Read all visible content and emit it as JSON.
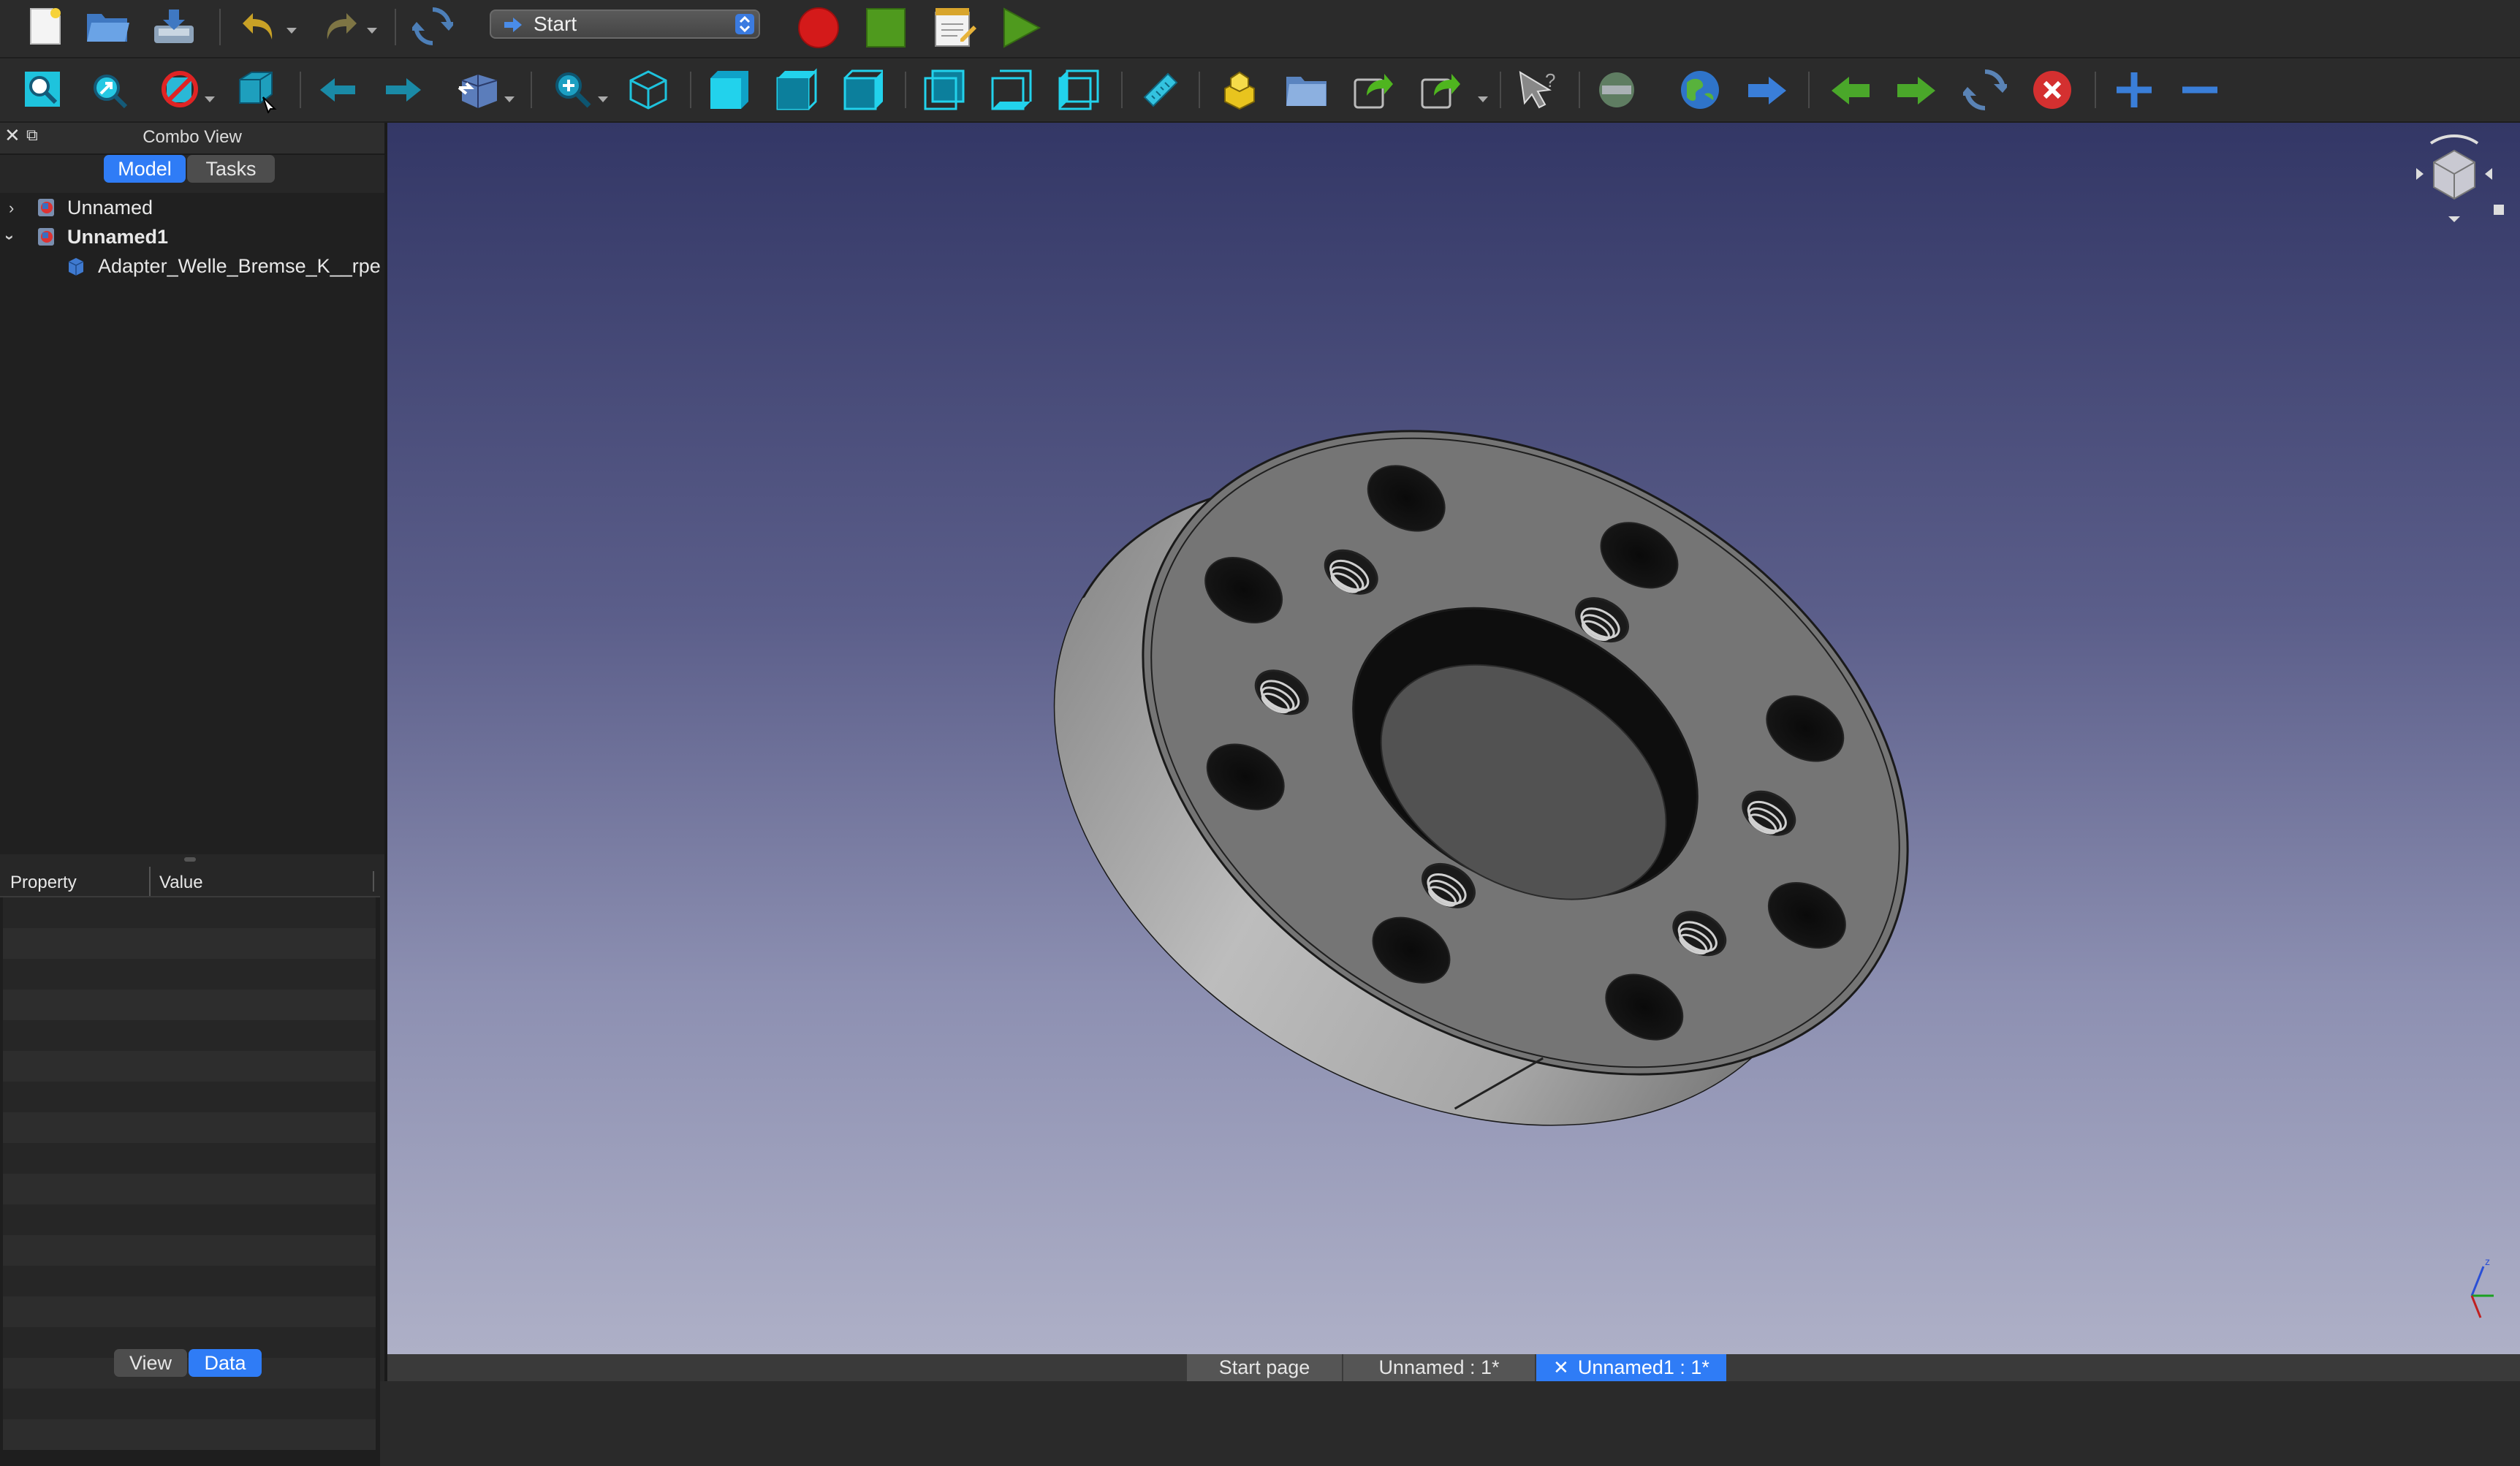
{
  "toolbar_top": {
    "workbench": "Start"
  },
  "combo_view": {
    "title": "Combo View",
    "tabs": [
      "Model",
      "Tasks"
    ],
    "active_tab": "Model",
    "tree": [
      {
        "label": "Unnamed",
        "expanded": false,
        "bold": false
      },
      {
        "label": "Unnamed1",
        "expanded": true,
        "bold": true
      },
      {
        "label": "Adapter_Welle_Bremse_K__rpe",
        "child": true
      }
    ]
  },
  "property_panel": {
    "columns": [
      "Property",
      "Value"
    ],
    "tabs": [
      "View",
      "Data"
    ],
    "active_tab": "Data"
  },
  "document_tabs": [
    {
      "label": "Start page",
      "active": false
    },
    {
      "label": "Unnamed : 1*",
      "active": false
    },
    {
      "label": "Unnamed1 : 1*",
      "active": true
    }
  ],
  "colors": {
    "accent": "#2f7cf6",
    "viewport_top": "#333766",
    "viewport_bottom": "#aeb0c7",
    "record": "#d41a1a",
    "stop": "#4f9a1e"
  },
  "icons": {
    "file": [
      "new-document-icon",
      "open-folder-icon",
      "save-icon",
      "undo-icon",
      "redo-icon",
      "refresh-icon"
    ],
    "macro": [
      "record-macro-icon",
      "stop-macro-icon",
      "edit-macro-icon",
      "run-macro-icon"
    ],
    "view": [
      "fit-all-icon",
      "fit-selection-icon",
      "draw-style-icon",
      "bounding-box-icon",
      "back-icon",
      "forward-icon",
      "std-views-icon",
      "zoom-icon",
      "isometric-icon",
      "front-view-icon",
      "top-view-icon",
      "right-view-icon",
      "rear-view-icon",
      "bottom-view-icon",
      "left-view-icon",
      "measure-icon",
      "part-icon",
      "group-icon",
      "link-icon",
      "link-actions-icon",
      "whats-this-icon"
    ],
    "web": [
      "web-settings-icon",
      "web-home-icon",
      "web-go-icon",
      "web-back-icon",
      "web-forward-icon",
      "web-refresh-icon",
      "web-stop-icon",
      "zoom-in-icon",
      "zoom-out-icon"
    ]
  }
}
